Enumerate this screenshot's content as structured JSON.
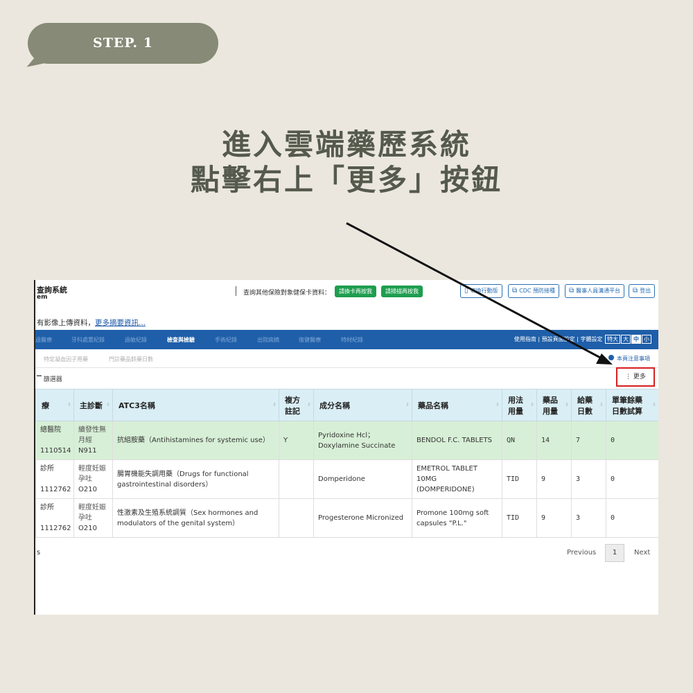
{
  "step": {
    "label": "STEP. 1"
  },
  "headline": {
    "line1": "進入雲端藥歷系統",
    "line2": "點擊右上「更多」按鈕"
  },
  "app": {
    "title": "查詢系統",
    "subtitle": "em",
    "other_card_label": "查詢其他保險對象健保卡資料：",
    "green_buttons": [
      "請換卡再按我",
      "請掃描再按我"
    ],
    "outline_buttons": [
      {
        "label": "切換行動版",
        "icon": "phone-icon"
      },
      {
        "label": "CDC 預防接種",
        "icon": "external-link-icon"
      },
      {
        "label": "醫事人員溝通平台",
        "icon": "external-link-icon"
      },
      {
        "label": "登出",
        "icon": "external-link-icon"
      }
    ],
    "notice": {
      "prefix": "有影像上傳資料，",
      "link": "更多摘要資訊..."
    },
    "nav": {
      "items": [
        "過醫療",
        "牙科處置紀錄",
        "過敏紀錄",
        "檢查與檢驗",
        "手術紀錄",
        "出院病摘",
        "復健醫療",
        "特材紀錄"
      ],
      "active_index": 3,
      "right_text": "使用指南 | 預設頁面設定 | 字體設定",
      "font_sizes": [
        "特大",
        "大",
        "中",
        "小"
      ],
      "font_size_selected": 2
    },
    "subtabs": [
      "特定凝血因子用藥",
      "門診藥品餘藥日數"
    ],
    "notice_link": "本頁注意事項",
    "filter_label": "篩選器",
    "more_button": {
      "icon": "vertical-dots-icon",
      "label": "更多"
    },
    "table": {
      "headers": [
        "療",
        "主診斷",
        "ATC3名稱",
        "複方\n註記",
        "成分名稱",
        "藥品名稱",
        "用法\n用量",
        "藥品\n用量",
        "給藥\n日數",
        "單筆餘藥\n日數試算"
      ],
      "rows": [
        {
          "hospital": "總醫院",
          "code": "1110514",
          "diag": "續發性無\n月經",
          "diag_code": "N911",
          "atc3": "抗組胺藥（Antihistamines for systemic use）",
          "compound": "Y",
          "ingredient": "Pyridoxine Hcl；\nDoxylamine Succinate",
          "drug": "BENDOL F.C. TABLETS",
          "usage": "QN",
          "qty": "14",
          "days": "7",
          "remain": "0"
        },
        {
          "hospital": "診所",
          "code": "1112762",
          "diag": "輕度妊娠\n孕吐",
          "diag_code": "O210",
          "atc3": "腸胃機能失調用藥（Drugs for functional gastrointestinal disorders）",
          "compound": "",
          "ingredient": "Domperidone",
          "drug": "EMETROL TABLET\n10MG\n(DOMPERIDONE)",
          "usage": "TID",
          "qty": "9",
          "days": "3",
          "remain": "0"
        },
        {
          "hospital": "診所",
          "code": "1112762",
          "diag": "輕度妊娠\n孕吐",
          "diag_code": "O210",
          "atc3": "性激素及生殖系統調質（Sex hormones and modulators of the genital system）",
          "compound": "",
          "ingredient": "Progesterone Micronized",
          "drug": "Promone 100mg soft\ncapsules \"P.L.\"",
          "usage": "TID",
          "qty": "9",
          "days": "3",
          "remain": "0"
        }
      ]
    },
    "footer_left": "s",
    "pager": {
      "prev": "Previous",
      "page": "1",
      "next": "Next"
    }
  },
  "colors": {
    "background": "#ebe7de",
    "bubble": "#868a76",
    "headline": "#555a4d",
    "nav": "#1f5fa9",
    "green_button": "#1e9e4e",
    "highlight_row": "#d7efd6",
    "header_cell": "#daeef5",
    "more_border": "#d62020"
  }
}
